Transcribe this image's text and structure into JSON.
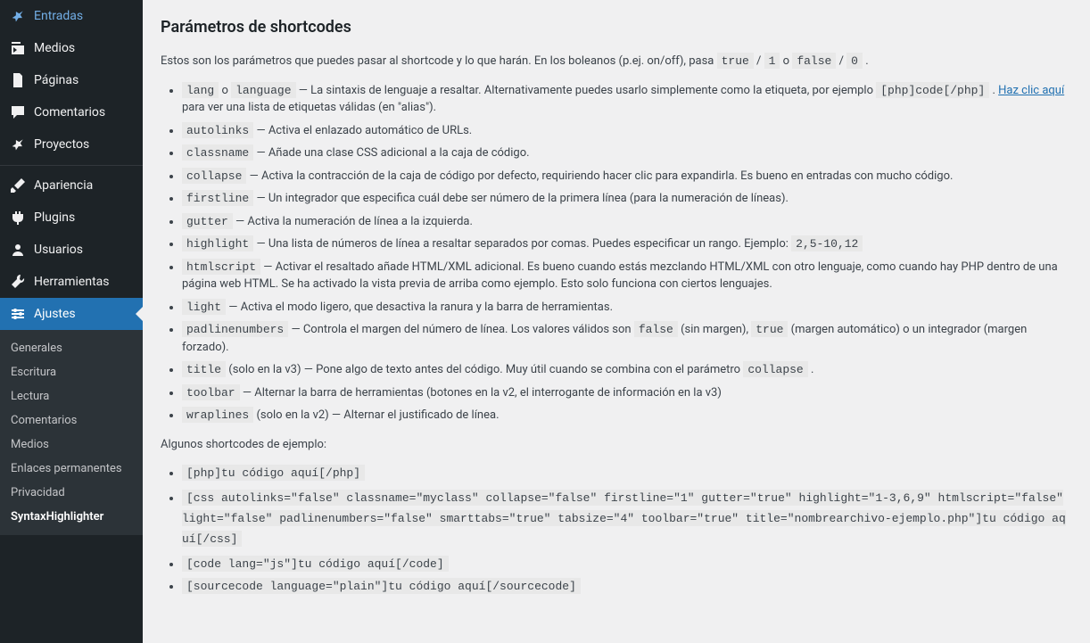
{
  "sidebar": {
    "main_items": [
      {
        "label": "Entradas",
        "icon": "pin"
      },
      {
        "label": "Medios",
        "icon": "media"
      },
      {
        "label": "Páginas",
        "icon": "pages"
      },
      {
        "label": "Comentarios",
        "icon": "comment"
      },
      {
        "label": "Proyectos",
        "icon": "pin"
      }
    ],
    "appearance_items": [
      {
        "label": "Apariencia",
        "icon": "brush"
      },
      {
        "label": "Plugins",
        "icon": "plugin"
      },
      {
        "label": "Usuarios",
        "icon": "user"
      },
      {
        "label": "Herramientas",
        "icon": "tools"
      },
      {
        "label": "Ajustes",
        "icon": "settings",
        "active": true
      }
    ],
    "submenu": [
      {
        "label": "Generales"
      },
      {
        "label": "Escritura"
      },
      {
        "label": "Lectura"
      },
      {
        "label": "Comentarios"
      },
      {
        "label": "Medios"
      },
      {
        "label": "Enlaces permanentes"
      },
      {
        "label": "Privacidad"
      },
      {
        "label": "SyntaxHighlighter",
        "current": true
      }
    ]
  },
  "content": {
    "heading": "Parámetros de shortcodes",
    "intro_pre": "Estos son los parámetros que puedes pasar al shortcode y lo que harán. En los boleanos (p.ej. on/off), pasa ",
    "true_code": "true",
    "slash1": " / ",
    "one_code": "1",
    "or_text": " o ",
    "false_code": "false",
    "slash2": " / ",
    "zero_code": "0",
    "period": " .",
    "params": [
      {
        "code": "lang",
        "or": " o ",
        "code2": "language",
        "text": " — La sintaxis de lenguaje a resaltar. Alternativamente puedes usarlo simplemente como la etiqueta, por ejemplo ",
        "code3": "[php]code[/php]",
        "post": " . ",
        "link": "Haz clic aquí",
        "tail": " para ver una lista de etiquetas válidas (en \"alias\")."
      },
      {
        "code": "autolinks",
        "text": " — Activa el enlazado automático de URLs."
      },
      {
        "code": "classname",
        "text": " — Añade una clase CSS adicional a la caja de código."
      },
      {
        "code": "collapse",
        "text": " — Activa la contracción de la caja de código por defecto, requiriendo hacer clic para expandirla. Es bueno en entradas con mucho código."
      },
      {
        "code": "firstline",
        "text": " — Un integrador que especifica cuál debe ser número de la primera línea (para la numeración de líneas)."
      },
      {
        "code": "gutter",
        "text": " — Activa la numeración de línea a la izquierda."
      },
      {
        "code": "highlight",
        "text": " — Una lista de números de línea a resaltar separados por comas. Puedes especificar un rango. Ejemplo: ",
        "code3": "2,5-10,12"
      },
      {
        "code": "htmlscript",
        "text": " — Activar el resaltado añade HTML/XML adicional. Es bueno cuando estás mezclando HTML/XML con otro lenguaje, como cuando hay PHP dentro de una página web HTML. Se ha activado la vista previa de arriba como ejemplo. Esto solo funciona con ciertos lenguajes."
      },
      {
        "code": "light",
        "text": " — Activa el modo ligero, que desactiva la ranura y la barra de herramientas."
      },
      {
        "code": "padlinenumbers",
        "text": " — Controla el margen del número de línea. Los valores válidos son ",
        "code3": "false",
        "mid": " (sin margen), ",
        "code4": "true",
        "tail": " (margen automático) o un integrador (margen forzado)."
      },
      {
        "code": "title",
        "text": " (solo en la v3) — Pone algo de texto antes del código. Muy útil cuando se combina con el parámetro ",
        "code3": "collapse",
        "tail": " ."
      },
      {
        "code": "toolbar",
        "text": " — Alternar la barra de herramientas (botones en la v2, el interrogante de información en la v3)"
      },
      {
        "code": "wraplines",
        "text": " (solo en la v2) — Alternar el justificado de línea."
      }
    ],
    "examples_intro": "Algunos shortcodes de ejemplo:",
    "examples": [
      "[php]tu código aquí[/php]",
      "[css autolinks=\"false\" classname=\"myclass\" collapse=\"false\" firstline=\"1\" gutter=\"true\" highlight=\"1-3,6,9\" htmlscript=\"false\" light=\"false\" padlinenumbers=\"false\" smarttabs=\"true\" tabsize=\"4\" toolbar=\"true\" title=\"nombrearchivo-ejemplo.php\"]tu código aquí[/css]",
      "[code lang=\"js\"]tu código aquí[/code]",
      "[sourcecode language=\"plain\"]tu código aquí[/sourcecode]"
    ]
  }
}
